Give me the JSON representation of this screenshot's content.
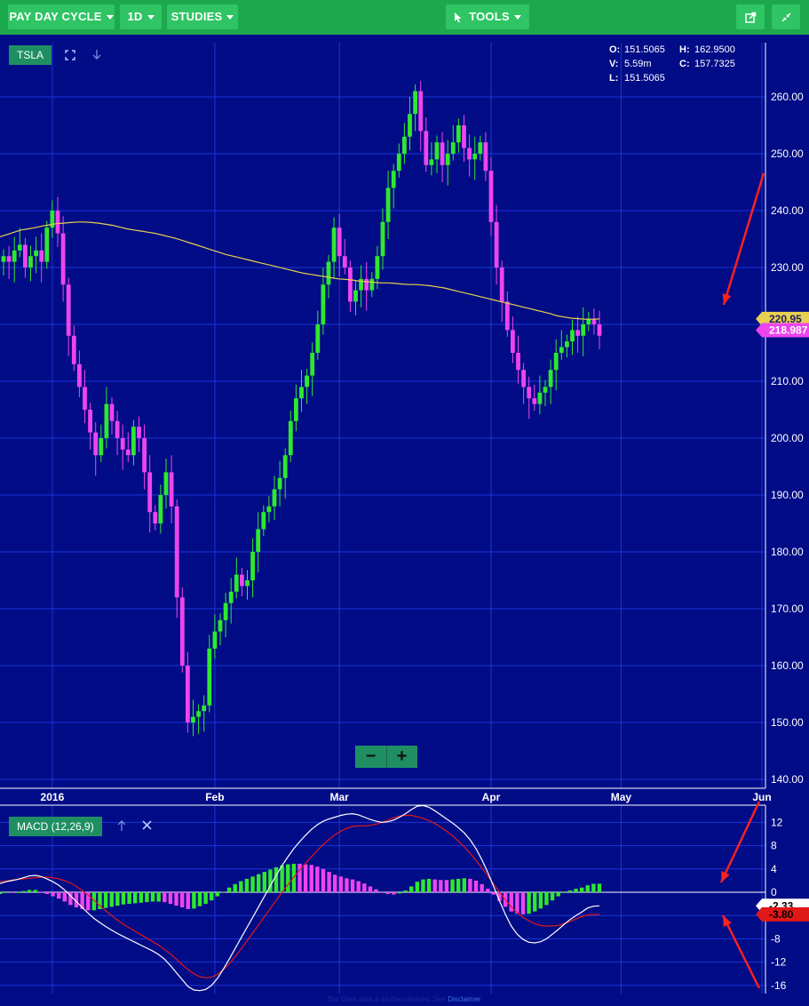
{
  "toolbar": {
    "cycle_label": "PAY DAY CYCLE",
    "interval_label": "1D",
    "studies_label": "STUDIES",
    "tools_label": "TOOLS",
    "icons": [
      "share-icon",
      "collapse-icon"
    ]
  },
  "chart": {
    "symbol": "TSLA",
    "ohlc": {
      "O": "151.5065",
      "H": "162.9500",
      "V": "5.59m",
      "C": "157.7325",
      "L": "151.5065"
    },
    "zoom_out_label": "−",
    "zoom_in_label": "+",
    "icons": [
      "fullscreen-icon",
      "download-arrow-icon",
      "up-arrow-icon",
      "close-icon"
    ]
  },
  "macd": {
    "label": "MACD (12,26,9)"
  },
  "credits": {
    "text": "Bar chart data & studies derived. See",
    "link": "Disclaimer"
  },
  "colors": {
    "background": "#020c86",
    "up_candle": "#2ee82e",
    "down_candle": "#ee44ee",
    "ma_line": "#e8d050",
    "macd_line": "#ffffff",
    "signal_line": "#e01818",
    "annotation": "#ff2020",
    "toolbar": "#1ea84e"
  },
  "chart_data": [
    {
      "type": "candlestick",
      "series": [
        {
          "name": "TSLA"
        }
      ],
      "x_ticks": [
        "2016",
        "Feb",
        "Mar",
        "Apr",
        "May",
        "Jun"
      ],
      "x_tick_index": [
        9,
        39,
        62,
        90,
        114,
        140
      ],
      "ylim": [
        139,
        269
      ],
      "y_ticks": [
        140,
        150,
        160,
        170,
        180,
        190,
        200,
        210,
        220,
        230,
        240,
        250,
        260
      ],
      "y_tick_labels": [
        "140.00",
        "150.00",
        "160.00",
        "170.00",
        "180.00",
        "190.00",
        "200.00",
        "210.00",
        "220.00",
        "230.00",
        "240.00",
        "250.00",
        "260.00"
      ],
      "close": [
        232,
        231,
        233,
        234,
        230,
        232,
        233,
        231,
        237,
        240,
        236,
        227,
        218,
        213,
        209,
        205,
        201,
        197,
        200,
        206,
        203,
        200,
        198,
        197,
        202,
        200,
        194,
        187,
        185,
        190,
        194,
        188,
        172,
        160,
        150,
        151,
        152,
        153,
        163,
        166,
        168,
        171,
        173,
        176,
        174,
        175,
        180,
        184,
        187,
        188,
        191,
        193,
        197,
        203,
        207,
        209,
        211,
        215,
        220,
        227,
        231,
        237,
        232,
        230,
        224,
        226,
        228,
        226,
        228,
        232,
        238,
        244,
        247,
        250,
        253,
        257,
        261,
        254,
        248,
        249,
        252,
        248,
        250,
        252,
        255,
        251,
        249,
        250,
        252,
        247,
        238,
        230,
        224,
        219,
        215,
        212,
        209,
        207,
        206,
        208,
        209,
        212,
        215,
        216,
        217,
        219,
        218,
        220,
        221,
        220,
        218
      ],
      "ma": {
        "name": "",
        "values": [
          235.4,
          235.8,
          236.2,
          236.6,
          236.8,
          237.0,
          237.3,
          237.5,
          237.7,
          237.8,
          237.9,
          238.0,
          238.0,
          237.9,
          237.8,
          237.6,
          237.4,
          237.1,
          236.8,
          236.6,
          236.4,
          236.2,
          236.0,
          235.7,
          235.4,
          235.1,
          234.7,
          234.3,
          233.9,
          233.5,
          233.1,
          232.7,
          232.3,
          232.0,
          231.7,
          231.4,
          231.1,
          230.8,
          230.5,
          230.2,
          229.9,
          229.6,
          229.3,
          229.0,
          228.8,
          228.6,
          228.4,
          228.2,
          228.0,
          227.9,
          227.8,
          227.6,
          227.5,
          227.4,
          227.3,
          227.3,
          227.2,
          227.1,
          227.0,
          227.0,
          226.9,
          226.8,
          226.6,
          226.4,
          226.1,
          225.8,
          225.5,
          225.2,
          224.9,
          224.6,
          224.3,
          224.0,
          223.7,
          223.4,
          223.1,
          222.8,
          222.5,
          222.2,
          221.9,
          221.5,
          221.3,
          221.1,
          221.0,
          220.9,
          220.9,
          220.95
        ]
      },
      "last_labels": [
        "220.95",
        "218.987"
      ]
    },
    {
      "type": "bar",
      "series": [
        {
          "name": "MACD (12,26,9)",
          "values": [
            1.5,
            1.8,
            2.0,
            2.2,
            2.5,
            2.8,
            2.9,
            2.7,
            2.3,
            1.8,
            1.2,
            0.4,
            -0.6,
            -1.6,
            -2.6,
            -3.6,
            -4.5,
            -5.2,
            -5.9,
            -6.5,
            -7.1,
            -7.6,
            -8.1,
            -8.6,
            -9.1,
            -9.6,
            -10.1,
            -10.7,
            -11.5,
            -12.6,
            -13.8,
            -15.0,
            -16.2,
            -16.8,
            -16.9,
            -16.7,
            -16.0,
            -14.8,
            -13.2,
            -11.5,
            -9.7,
            -7.9,
            -6.1,
            -4.3,
            -2.5,
            -0.7,
            1.1,
            2.9,
            4.6,
            6.1,
            7.5,
            8.7,
            9.8,
            10.8,
            11.6,
            12.2,
            12.6,
            12.9,
            13.2,
            13.4,
            13.5,
            13.3,
            12.9,
            12.5,
            12.2,
            12.0,
            12.1,
            12.4,
            12.9,
            13.5,
            14.2,
            14.8,
            14.9,
            14.6,
            14.0,
            13.3,
            12.6,
            11.9,
            11.1,
            10.2,
            9.0,
            7.5,
            5.6,
            3.4,
            1.0,
            -1.5,
            -3.8,
            -5.8,
            -7.2,
            -8.1,
            -8.6,
            -8.7,
            -8.5,
            -8.0,
            -7.2,
            -6.4,
            -5.5,
            -4.7,
            -4.0,
            -3.4,
            -2.7,
            -2.4,
            -2.33
          ]
        },
        {
          "name": "Signal",
          "values": [
            1.8,
            1.9,
            2.1,
            2.2,
            2.3,
            2.4,
            2.5,
            2.6,
            2.6,
            2.5,
            2.3,
            2.0,
            1.6,
            1.0,
            0.3,
            -0.5,
            -1.4,
            -2.3,
            -3.2,
            -4.0,
            -4.8,
            -5.5,
            -6.1,
            -6.7,
            -7.3,
            -7.9,
            -8.5,
            -9.1,
            -9.8,
            -10.6,
            -11.5,
            -12.4,
            -13.3,
            -14.0,
            -14.5,
            -14.7,
            -14.6,
            -14.1,
            -13.3,
            -12.3,
            -11.1,
            -9.8,
            -8.4,
            -7.0,
            -5.6,
            -4.2,
            -2.8,
            -1.4,
            0.0,
            1.3,
            2.6,
            3.8,
            5.0,
            6.1,
            7.2,
            8.2,
            9.1,
            9.9,
            10.5,
            11.0,
            11.3,
            11.4,
            11.4,
            11.5,
            11.7,
            12.0,
            12.4,
            12.8,
            13.1,
            13.2,
            13.2,
            13.0,
            12.7,
            12.3,
            11.8,
            11.2,
            10.5,
            9.7,
            8.8,
            7.8,
            6.7,
            5.5,
            4.2,
            2.8,
            1.4,
            0.0,
            -1.3,
            -2.5,
            -3.5,
            -4.3,
            -4.9,
            -5.4,
            -5.7,
            -5.8,
            -5.8,
            -5.7,
            -5.4,
            -5.0,
            -4.6,
            -4.2,
            -3.9,
            -3.85,
            -3.8
          ]
        }
      ],
      "histogram_name": "",
      "ylim": [
        -17,
        15
      ],
      "y_ticks": [
        -16,
        -12,
        -8,
        -4,
        0,
        4,
        8,
        12
      ],
      "y_tick_labels": [
        "-16",
        "-12",
        "-8",
        "-4",
        "0",
        "4",
        "8",
        "12"
      ],
      "last_labels": [
        "-2.33",
        "-3.80"
      ]
    }
  ]
}
